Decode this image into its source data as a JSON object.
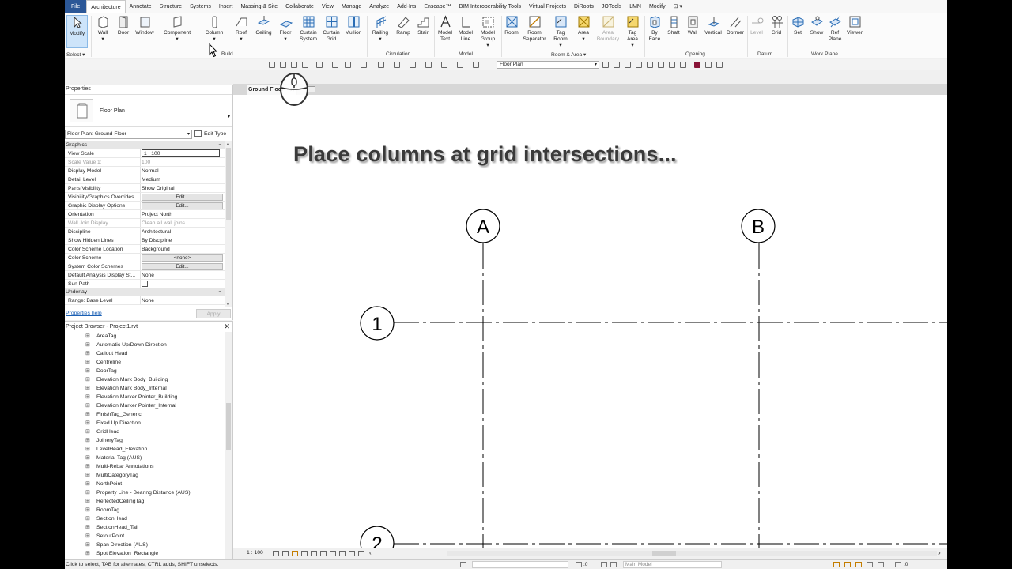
{
  "ribbon_tabs": [
    "File",
    "Architecture",
    "Annotate",
    "Structure",
    "Systems",
    "Insert",
    "Massing & Site",
    "Collaborate",
    "View",
    "Manage",
    "Analyze",
    "Add-Ins",
    "Enscape™",
    "BIM Interoperability Tools",
    "Virtual Projects",
    "DiRoots",
    "JOTools",
    "LMN",
    "Modify"
  ],
  "active_tab": "Architecture",
  "ribbon": {
    "modify": "Modify",
    "select_label": "Select",
    "build": {
      "wall": "Wall",
      "door": "Door",
      "window": "Window",
      "component": "Component",
      "column": "Column",
      "roof": "Roof",
      "ceiling": "Ceiling",
      "floor": "Floor",
      "curtain_system": "Curtain System",
      "curtain_grid": "Curtain Grid",
      "mullion": "Mullion",
      "label": "Build"
    },
    "circulation": {
      "railing": "Railing",
      "ramp": "Ramp",
      "stair": "Stair",
      "label": "Circulation"
    },
    "model": {
      "model_text": "Model Text",
      "model_line": "Model Line",
      "model_group": "Model Group",
      "label": "Model"
    },
    "room_area": {
      "room": "Room",
      "room_separator": "Room Separator",
      "tag_room": "Tag Room",
      "area": "Area",
      "area_boundary": "Area Boundary",
      "tag_area": "Tag Area",
      "label": "Room & Area"
    },
    "opening": {
      "by_face": "By Face",
      "shaft": "Shaft",
      "wall": "Wall",
      "vertical": "Vertical",
      "dormer": "Dormer",
      "label": "Opening"
    },
    "datum": {
      "level": "Level",
      "grid": "Grid",
      "label": "Datum"
    },
    "work_plane": {
      "set": "Set",
      "show": "Show",
      "ref_plane": "Ref Plane",
      "viewer": "Viewer",
      "label": "Work Plane"
    }
  },
  "qat": {
    "view_type": "Floor Plan"
  },
  "properties": {
    "title": "Properties",
    "type_name": "Floor Plan",
    "instance": "Floor Plan: Ground Floor",
    "edit_type": "Edit Type",
    "group_graphics": "Graphics",
    "rows": [
      {
        "name": "View Scale",
        "value": "1 : 100"
      },
      {
        "name": "Scale Value    1:",
        "value": "100"
      },
      {
        "name": "Display Model",
        "value": "Normal"
      },
      {
        "name": "Detail Level",
        "value": "Medium"
      },
      {
        "name": "Parts Visibility",
        "value": "Show Original"
      },
      {
        "name": "Visibility/Graphics Overrides",
        "value": "Edit..."
      },
      {
        "name": "Graphic Display Options",
        "value": "Edit..."
      },
      {
        "name": "Orientation",
        "value": "Project North"
      },
      {
        "name": "Wall Join Display",
        "value": "Clean all wall joins"
      },
      {
        "name": "Discipline",
        "value": "Architectural"
      },
      {
        "name": "Show Hidden Lines",
        "value": "By Discipline"
      },
      {
        "name": "Color Scheme Location",
        "value": "Background"
      },
      {
        "name": "Color Scheme",
        "value": "<none>"
      },
      {
        "name": "System Color Schemes",
        "value": "Edit..."
      },
      {
        "name": "Default Analysis Display St...",
        "value": "None"
      },
      {
        "name": "Sun Path",
        "value": ""
      }
    ],
    "group_underlay": "Underlay",
    "underlay_row": {
      "name": "Range: Base Level",
      "value": "None"
    },
    "help": "Properties help",
    "apply": "Apply"
  },
  "browser": {
    "title": "Project Browser - Project1.rvt",
    "items": [
      "AreaTag",
      "Automatic Up/Down Direction",
      "Callout Head",
      "Centreline",
      "DoorTag",
      "Elevation Mark Body_Building",
      "Elevation Mark Body_Internal",
      "Elevation Marker Pointer_Building",
      "Elevation Marker Pointer_Internal",
      "FinishTag_Generic",
      "Fixed Up Direction",
      "GridHead",
      "JoineryTag",
      "LevelHead_Elevation",
      "Material Tag (AUS)",
      "Multi-Rebar Annotations",
      "MultiCategoryTag",
      "NorthPoint",
      "Property Line - Bearing Distance (AUS)",
      "ReflectedCeilingTag",
      "RoomTag",
      "SectionHead",
      "SectionHead_Tail",
      "SetoutPoint",
      "Span Direction (AUS)",
      "Spot Elevation_Rectangle"
    ]
  },
  "view": {
    "tab_name": "Ground Floor",
    "hint": "Place columns at grid intersections...",
    "grids": {
      "a": "A",
      "b": "B",
      "one": "1",
      "two": "2"
    },
    "scale": "1 : 100"
  },
  "status": {
    "text": "Click to select, TAB for alternates, CTRL adds, SHIFT unselects.",
    "selection_count": ":0",
    "model": "Main Model",
    "filter_count": ":0"
  }
}
